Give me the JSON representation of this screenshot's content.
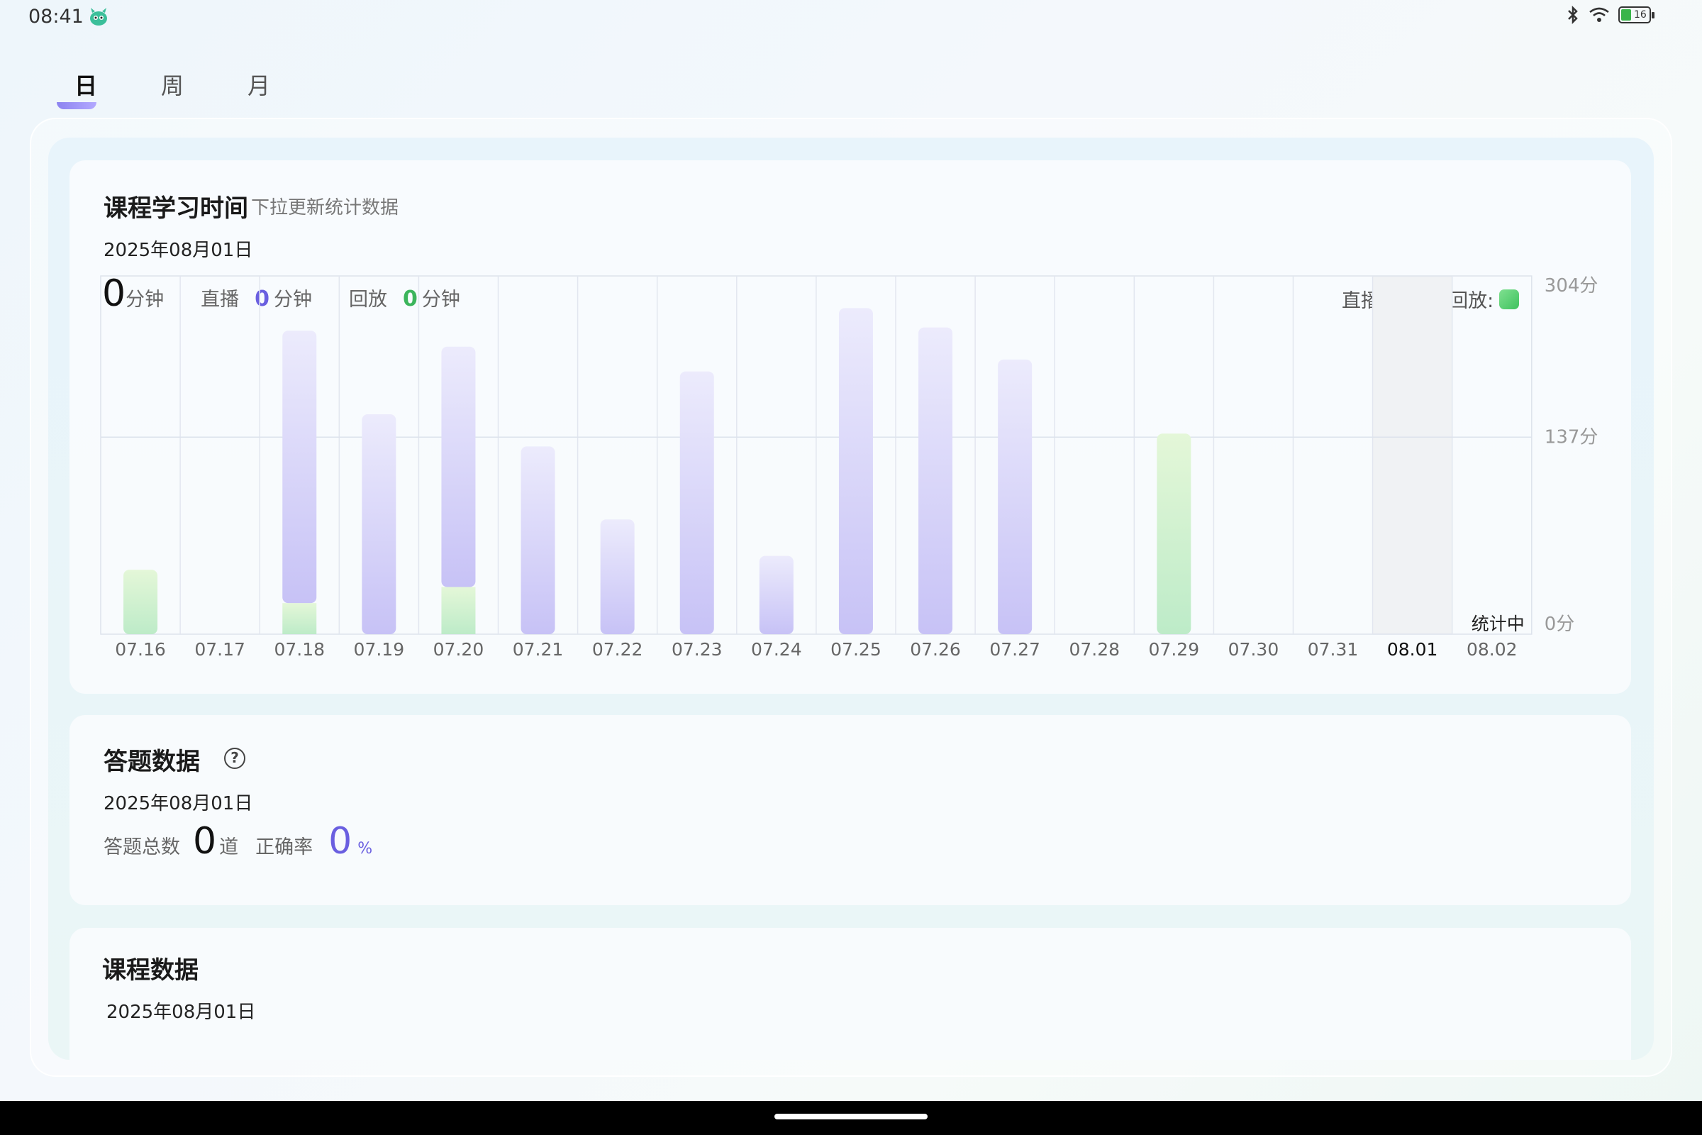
{
  "status_bar": {
    "time": "08:41",
    "battery": "16"
  },
  "tabs": [
    {
      "label": "日",
      "active": true
    },
    {
      "label": "周",
      "active": false
    },
    {
      "label": "月",
      "active": false
    }
  ],
  "study_time": {
    "title": "课程学习时间",
    "subtitle": "下拉更新统计数据",
    "date": "2025年08月01日",
    "total_value": "0",
    "total_unit": "分钟",
    "live_label": "直播",
    "live_value": "0",
    "live_unit": "分钟",
    "replay_label": "回放",
    "replay_value": "0",
    "replay_unit": "分钟",
    "legend_live": "直播:",
    "legend_replay": "回放:",
    "counting_label": "统计中"
  },
  "colors": {
    "live": "#8a80f2",
    "replay": "#5ed47a",
    "accent": "#6a5fe0"
  },
  "chart_data": {
    "type": "bar",
    "categories": [
      "07.16",
      "07.17",
      "07.18",
      "07.19",
      "07.20",
      "07.21",
      "07.22",
      "07.23",
      "07.24",
      "07.25",
      "07.26",
      "07.27",
      "07.28",
      "07.29",
      "07.30",
      "07.31",
      "08.01",
      "08.02"
    ],
    "series": [
      {
        "name": "直播",
        "values": [
          0,
          0,
          254,
          205,
          224,
          175,
          107,
          245,
          73,
          304,
          286,
          256,
          0,
          0,
          0,
          0,
          0,
          0
        ]
      },
      {
        "name": "回放",
        "values": [
          60,
          0,
          29,
          0,
          44,
          0,
          0,
          0,
          0,
          0,
          0,
          0,
          0,
          187,
          0,
          0,
          0,
          0
        ]
      }
    ],
    "stacked": true,
    "highlight_category": "08.01",
    "y_ticks": [
      "304分",
      "137分",
      "0分"
    ],
    "ylim": [
      0,
      334
    ]
  },
  "answer_data": {
    "title": "答题数据",
    "date": "2025年08月01日",
    "total_label": "答题总数",
    "total_value": "0",
    "total_unit": "道",
    "accuracy_label": "正确率",
    "accuracy_value": "0",
    "accuracy_unit": "%"
  },
  "course_data": {
    "title": "课程数据",
    "date": "2025年08月01日"
  }
}
